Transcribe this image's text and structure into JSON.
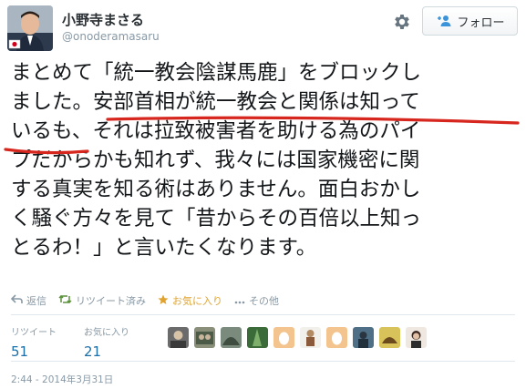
{
  "user": {
    "display_name": "小野寺まさる",
    "handle": "@onoderamasaru"
  },
  "header": {
    "settings_icon": "gear-icon",
    "follow_label": "フォロー",
    "follow_icon": "follow-person-plus-icon"
  },
  "tweet": {
    "lines": [
      "まとめて「統一教会陰謀馬鹿」をブロックし",
      "ました。安部首相が統一教会と関係は知って",
      "いるも、それは拉致被害者を助ける為のパイ",
      "プだからかも知れず、我々には国家機密に関",
      "する真実を知る術はありません。面白おかし",
      "く騒ぐ方々を見て「昔からその百倍以上知っ",
      "とるわ！」と言いたくなります。"
    ],
    "annotation_color": "#d7261d"
  },
  "actions": {
    "reply": "返信",
    "retweeted": "リツイート済み",
    "favorite": "お気に入り",
    "more": "その他",
    "favorite_color": "#e0a330"
  },
  "stats": {
    "retweets_label": "リツイート",
    "retweets_count": "51",
    "favorites_label": "お気に入り",
    "favorites_count": "21"
  },
  "timestamp": "2:44 - 2014年3月31日"
}
